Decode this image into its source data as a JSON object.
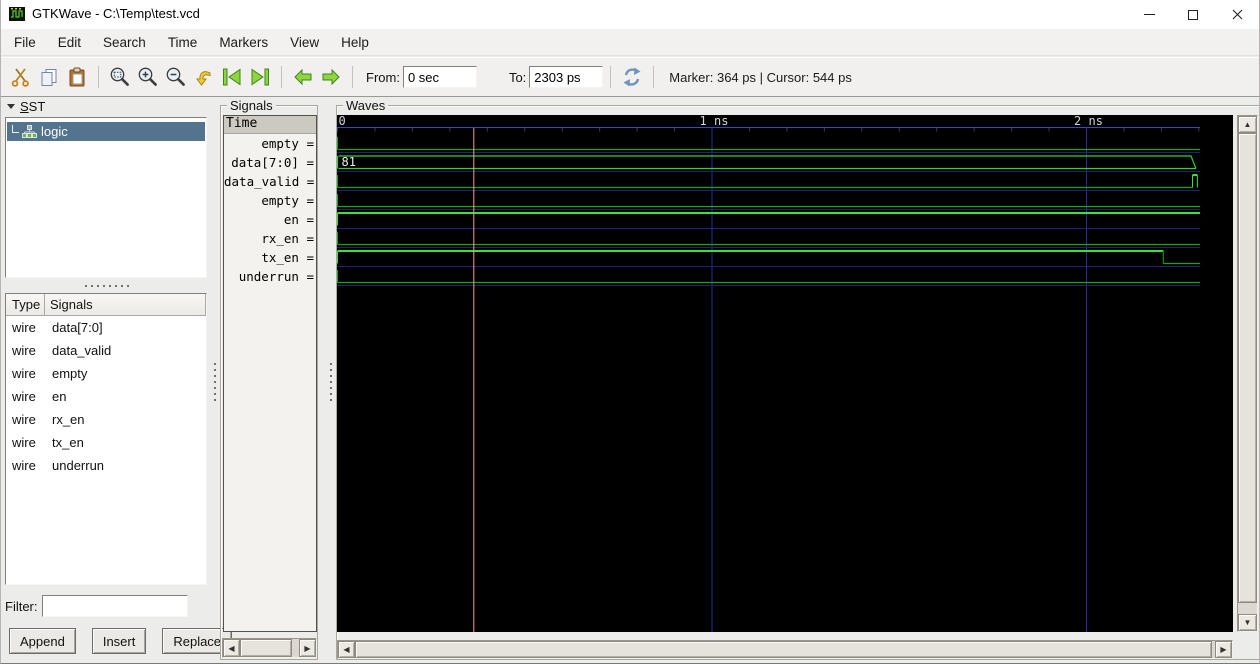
{
  "window": {
    "title": "GTKWave - C:\\Temp\\test.vcd"
  },
  "menu": [
    "File",
    "Edit",
    "Search",
    "Time",
    "Markers",
    "View",
    "Help"
  ],
  "toolbar": {
    "from_label": "From:",
    "from_value": "0 sec",
    "to_label": "To:",
    "to_value": "2303 ps",
    "status": "Marker: 364 ps  |  Cursor: 544 ps"
  },
  "sst": {
    "mnemonic": "S",
    "label_rest": "ST",
    "tree": {
      "root_label": "logic"
    },
    "table": {
      "headers": [
        "Type",
        "Signals"
      ],
      "rows": [
        [
          "wire",
          "data[7:0]"
        ],
        [
          "wire",
          "data_valid"
        ],
        [
          "wire",
          "empty"
        ],
        [
          "wire",
          "en"
        ],
        [
          "wire",
          "rx_en"
        ],
        [
          "wire",
          "tx_en"
        ],
        [
          "wire",
          "underrun"
        ]
      ]
    },
    "filter_label": "Filter:",
    "filter_value": "",
    "buttons": [
      "Append",
      "Insert",
      "Replace"
    ]
  },
  "signals_panel": {
    "frame_label": "Signals",
    "time_header": "Time",
    "items": [
      "empty =",
      "data[7:0] =",
      "data_valid =",
      "empty =",
      "en =",
      "rx_en =",
      "tx_en =",
      "underrun ="
    ]
  },
  "waves_panel": {
    "frame_label": "Waves",
    "t_end_ns": 2.303,
    "timeline_labels": [
      {
        "t": 0,
        "text": "0"
      },
      {
        "t": 1,
        "text": "1 ns"
      },
      {
        "t": 2,
        "text": "2 ns"
      }
    ],
    "tick_step_ns": 0.1,
    "grid_ts": [
      1,
      2
    ],
    "marker_t_ns": 0.364,
    "rows": [
      {
        "name": "empty",
        "kind": "wire",
        "segments": [
          {
            "t0": 0,
            "t1": 2.303,
            "v": 0
          }
        ]
      },
      {
        "name": "data[7:0]",
        "kind": "bus",
        "value": "81",
        "t0": 0,
        "t1": 2.295
      },
      {
        "name": "data_valid",
        "kind": "wire",
        "segments": [
          {
            "t0": 0,
            "t1": 2.283,
            "v": 0
          },
          {
            "t0": 2.283,
            "t1": 2.296,
            "v": 1
          }
        ]
      },
      {
        "name": "empty",
        "kind": "wire",
        "segments": [
          {
            "t0": 0,
            "t1": 2.303,
            "v": 0
          }
        ]
      },
      {
        "name": "en",
        "kind": "wire",
        "segments": [
          {
            "t0": 0,
            "t1": 2.303,
            "v": 1
          }
        ]
      },
      {
        "name": "rx_en",
        "kind": "wire",
        "segments": [
          {
            "t0": 0,
            "t1": 2.303,
            "v": 0
          }
        ]
      },
      {
        "name": "tx_en",
        "kind": "wire",
        "segments": [
          {
            "t0": 0,
            "t1": 2.205,
            "v": 1
          },
          {
            "t0": 2.205,
            "t1": 2.303,
            "v": 0
          }
        ]
      },
      {
        "name": "underrun",
        "kind": "wire",
        "segments": [
          {
            "t0": 0,
            "t1": 2.303,
            "v": 0
          }
        ]
      }
    ],
    "colors": {
      "low": "#17a617",
      "high": "#36e436",
      "bus": "#2dd42d",
      "baseline": "#4343c8",
      "row_sep": "#20207d",
      "grid_v": "#2b2b9e",
      "tick": "#3f3f3f",
      "marker": "#ff9a9a",
      "bus_text": "#eeeeee",
      "time_text": "#d6d6d6"
    }
  }
}
